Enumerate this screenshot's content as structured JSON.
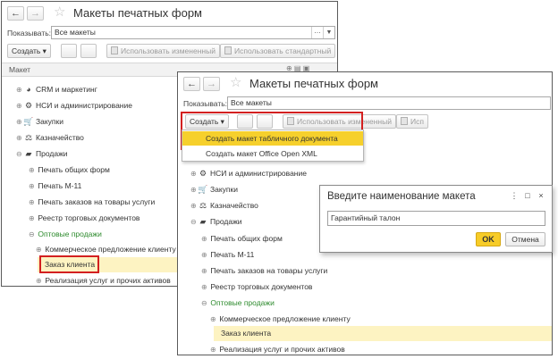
{
  "back_window": {
    "title": "Макеты печатных форм",
    "show_label": "Показывать:",
    "show_value": "Все макеты",
    "toolbar": {
      "create": "Создать",
      "use_changed": "Использовать измененный",
      "use_standard": "Использовать стандартный"
    },
    "column_header": "Макет",
    "tree": [
      {
        "label": "CRM и маркетинг",
        "icon": "chart-pie-icon"
      },
      {
        "label": "НСИ и администрирование",
        "icon": "gear-icon"
      },
      {
        "label": "Закупки",
        "icon": "cart-icon"
      },
      {
        "label": "Казначейство",
        "icon": "treasury-icon"
      },
      {
        "label": "Продажи",
        "icon": "bag-icon"
      },
      {
        "label": "Печать общих форм"
      },
      {
        "label": "Печать М-11"
      },
      {
        "label": "Печать заказов на товары услуги"
      },
      {
        "label": "Реестр торговых документов"
      },
      {
        "label": "Оптовые продажи"
      },
      {
        "label": "Коммерческое предложение клиенту"
      },
      {
        "label": "Заказ клиента"
      },
      {
        "label": "Реализация услуг и прочих активов"
      }
    ]
  },
  "front_window": {
    "title": "Макеты печатных форм",
    "show_label": "Показывать:",
    "show_value": "Все макеты",
    "toolbar": {
      "create": "Создать",
      "use_changed": "Использовать измененный",
      "use_short": "Исп"
    },
    "create_menu": [
      "Создать макет табличного документа",
      "Создать макет Office Open XML"
    ],
    "tree": [
      {
        "label": "НСИ и администрирование",
        "icon": "gear-icon"
      },
      {
        "label": "Закупки",
        "icon": "cart-icon"
      },
      {
        "label": "Казначейство",
        "icon": "treasury-icon"
      },
      {
        "label": "Продажи",
        "icon": "bag-icon"
      },
      {
        "label": "Печать общих форм"
      },
      {
        "label": "Печать М-11"
      },
      {
        "label": "Печать заказов на товары услуги"
      },
      {
        "label": "Реестр торговых документов"
      },
      {
        "label": "Оптовые продажи"
      },
      {
        "label": "Коммерческое предложение клиенту"
      },
      {
        "label": "Заказ клиента"
      },
      {
        "label": "Реализация услуг и прочих активов"
      }
    ]
  },
  "dialog": {
    "title": "Введите наименование макета",
    "input_value": "Гарантийный талон",
    "ok": "OK",
    "cancel": "Отмена",
    "window_buttons": {
      "more": "⋮",
      "maximize": "□",
      "close": "×"
    }
  },
  "colors": {
    "accent_yellow": "#f6d02c",
    "highlight_row": "#fdf3c2",
    "red_frame": "#d32020",
    "group_green": "#2e8b2e"
  }
}
